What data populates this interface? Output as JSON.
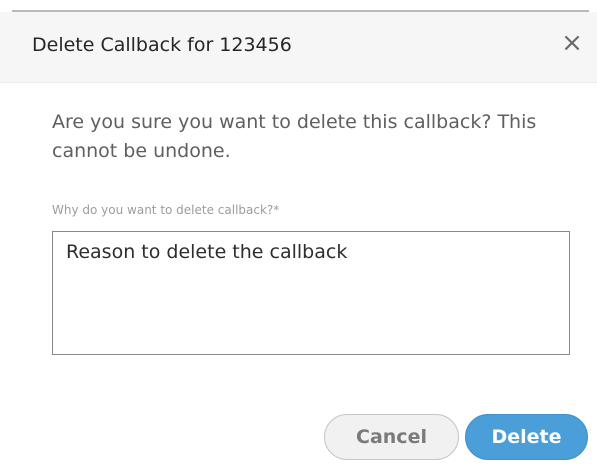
{
  "dialog": {
    "title": "Delete Callback for 123456",
    "close_symbol": "×",
    "message": "Are you sure you want to delete this callback? This cannot be undone.",
    "reason_field": {
      "label": "Why do you want to delete callback?*",
      "value": "Reason to delete the callback"
    },
    "buttons": {
      "cancel_label": "Cancel",
      "delete_label": "Delete"
    }
  },
  "colors": {
    "primary_button": "#4a9fd9",
    "header_background": "#f6f6f6"
  }
}
